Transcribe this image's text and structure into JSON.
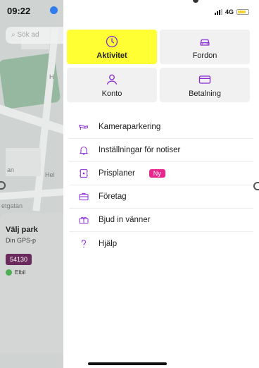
{
  "background": {
    "status_time": "09:22",
    "search_placeholder": "Sök ad",
    "map_labels": [
      "H",
      "Hel",
      "an",
      "etgatan"
    ],
    "card": {
      "title": "Välj park",
      "subtitle": "Din GPS-p",
      "plate": "54130",
      "elbil_label": "Elbil"
    }
  },
  "status_bar": {
    "network": "4G"
  },
  "tiles": [
    {
      "label": "Aktivitet",
      "icon": "clock-icon",
      "highlighted": true
    },
    {
      "label": "Fordon",
      "icon": "car-icon",
      "highlighted": false
    },
    {
      "label": "Konto",
      "icon": "user-icon",
      "highlighted": false
    },
    {
      "label": "Betalning",
      "icon": "card-icon",
      "highlighted": false
    }
  ],
  "menu": [
    {
      "label": "Kameraparkering",
      "icon": "camera-icon"
    },
    {
      "label": "Inställningar för notiser",
      "icon": "bell-icon"
    },
    {
      "label": "Prisplaner",
      "icon": "priceplan-icon",
      "badge": "Ny"
    },
    {
      "label": "Företag",
      "icon": "briefcase-icon"
    },
    {
      "label": "Bjud in vänner",
      "icon": "gift-icon"
    },
    {
      "label": "Hjälp",
      "icon": "question-icon"
    }
  ],
  "colors": {
    "accent": "#8a2bd6",
    "highlight": "#ffff33",
    "badge": "#e6278c"
  }
}
